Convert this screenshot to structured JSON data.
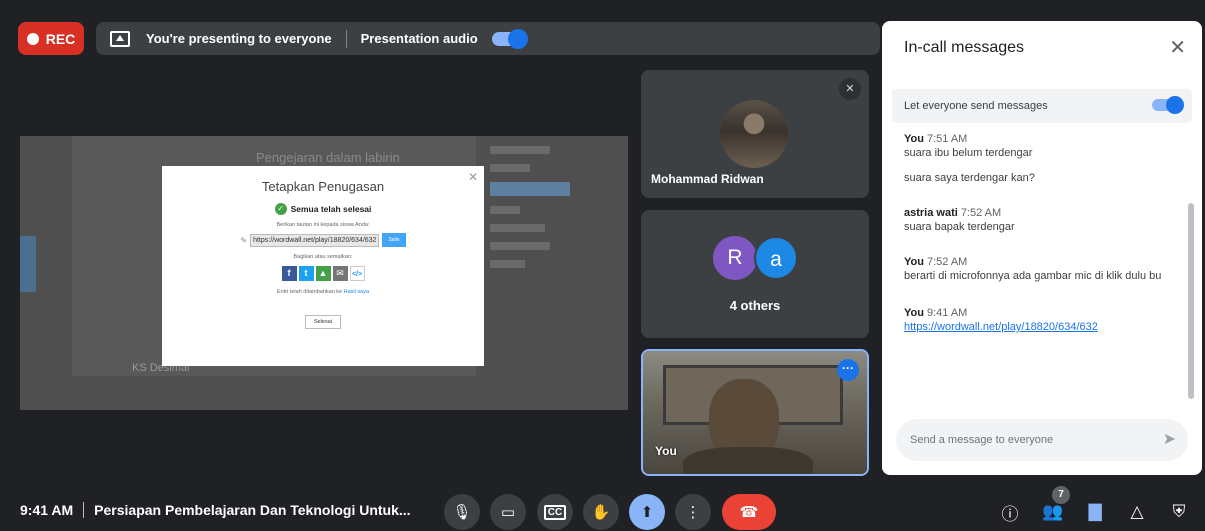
{
  "topbar": {
    "rec_label": "REC",
    "presenting_text": "You're presenting to everyone",
    "presentation_audio_label": "Presentation audio"
  },
  "presentation": {
    "bg_title": "Pengejaran dalam labirin",
    "bg_footer": "KS Desimal",
    "dialog": {
      "title": "Tetapkan Penugasan",
      "done_text": "Semua telah selesai",
      "link_prompt": "Berikan tautan ini kepada siswa Anda:",
      "link": "https://wordwall.net/play/18820/634/632",
      "copy_label": "Salin",
      "share_prompt": "Bagikan atau sematkan:",
      "note_prefix": "Entri telah ditambahkan ke",
      "note_link": "Hasil saya",
      "done_button": "Selesai"
    }
  },
  "participants": [
    {
      "name": "Mohammad Ridwan",
      "muted": true
    },
    {
      "group_label": "4 others",
      "initials": [
        "R",
        "a"
      ],
      "colors": [
        "#7e57c2",
        "#1e88e5"
      ]
    },
    {
      "name": "You"
    }
  ],
  "chat": {
    "title": "In-call messages",
    "allow_label": "Let everyone send messages",
    "messages": [
      {
        "sender": "You",
        "time": "7:51 AM",
        "lines": [
          "suara ibu belum terdengar",
          "suara saya terdengar kan?"
        ]
      },
      {
        "sender": "astria wati",
        "time": "7:52 AM",
        "lines": [
          "suara bapak terdengar"
        ]
      },
      {
        "sender": "You",
        "time": "7:52 AM",
        "lines": [
          "berarti di microfonnya ada gambar mic di klik dulu bu"
        ]
      },
      {
        "sender": "You",
        "time": "9:41 AM",
        "link": "https://wordwall.net/play/18820/634/632"
      }
    ],
    "input_placeholder": "Send a message to everyone"
  },
  "bottombar": {
    "time": "9:41 AM",
    "meeting_title": "Persiapan Pembelajaran Dan Teknologi Untuk...",
    "people_count": "7"
  },
  "colors": {
    "accent": "#8ab4f8",
    "end_call": "#ea4335",
    "rec": "#d93025"
  }
}
